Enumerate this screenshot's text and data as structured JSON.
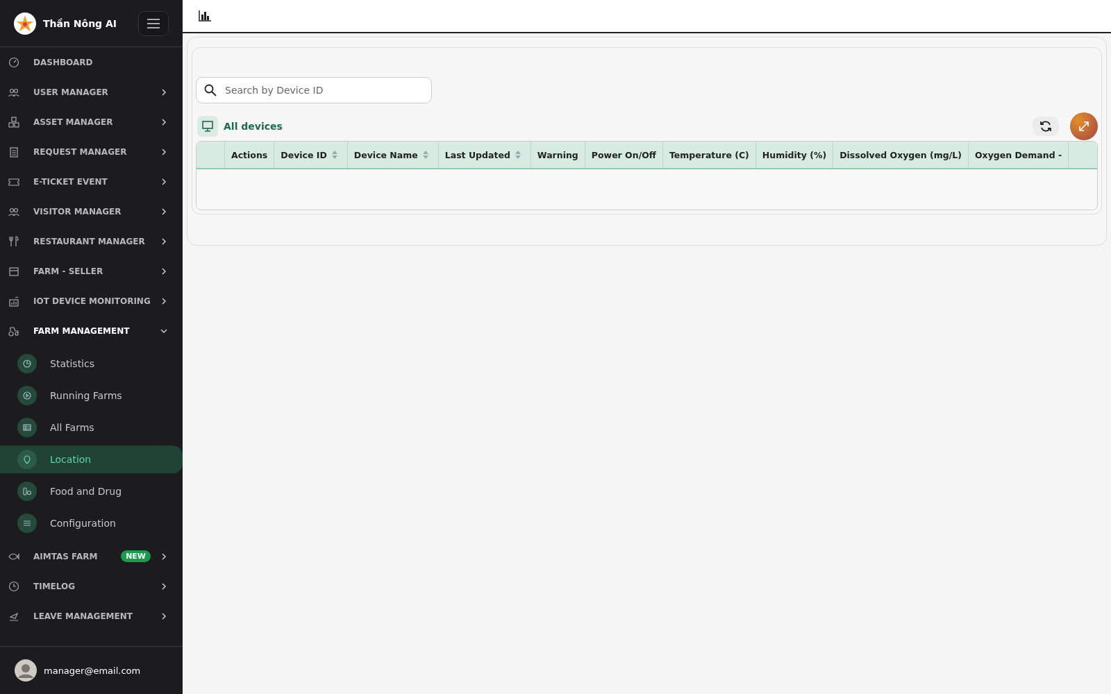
{
  "sidebar": {
    "brand": "Thần Nông AI",
    "items": [
      {
        "label": "DASHBOARD"
      },
      {
        "label": "USER MANAGER",
        "expanded": false
      },
      {
        "label": "ASSET MANAGER",
        "expanded": false
      },
      {
        "label": "REQUEST MANAGER",
        "expanded": false
      },
      {
        "label": "E-TICKET EVENT",
        "expanded": false
      },
      {
        "label": "VISITOR MANAGER",
        "expanded": false
      },
      {
        "label": "RESTAURANT MANAGER",
        "expanded": false
      },
      {
        "label": "FARM - SELLER",
        "expanded": false
      },
      {
        "label": "IOT DEVICE MONITORING",
        "expanded": false
      },
      {
        "label": "FARM MANAGEMENT",
        "expanded": true,
        "children": [
          {
            "label": "Statistics",
            "selected": false
          },
          {
            "label": "Running Farms",
            "selected": false
          },
          {
            "label": "All Farms",
            "selected": false
          },
          {
            "label": "Location",
            "selected": true
          },
          {
            "label": "Food and Drug",
            "selected": false
          },
          {
            "label": "Configuration",
            "selected": false
          }
        ]
      },
      {
        "label": "AIMTAS FARM",
        "badge": "NEW",
        "expanded": false
      },
      {
        "label": "TIMELOG",
        "expanded": false
      },
      {
        "label": "LEAVE MANAGEMENT",
        "expanded": false
      }
    ],
    "user": "manager@email.com"
  },
  "search": {
    "placeholder": "Search by Device ID"
  },
  "section_title": "All devices",
  "table": {
    "columns": [
      {
        "label": "Actions",
        "sortable": false
      },
      {
        "label": "Device ID",
        "sortable": true
      },
      {
        "label": "Device Name",
        "sortable": true
      },
      {
        "label": "Last Updated",
        "sortable": true
      },
      {
        "label": "Warning",
        "sortable": false
      },
      {
        "label": "Power On/Off",
        "sortable": false
      },
      {
        "label": "Temperature (C)",
        "sortable": false
      },
      {
        "label": "Humidity (%)",
        "sortable": false
      },
      {
        "label": "Dissolved Oxygen (mg/L)",
        "sortable": false
      },
      {
        "label": "Oxygen Demand -",
        "sortable": false
      }
    ]
  }
}
